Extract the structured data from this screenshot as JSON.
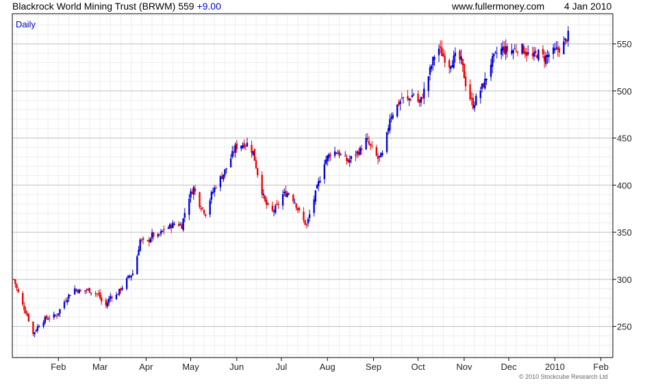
{
  "header": {
    "title": "Blackrock World Mining Trust (BRWM) 559",
    "change": "+9.00",
    "site": "www.fullermoney.com",
    "date": "4 Jan 2010"
  },
  "footer": {
    "copyright": "© 2010 Stockcube Research Ltd"
  },
  "colors": {
    "up": "#0000dd",
    "down": "#ee0000",
    "grid": "#d4d4d4",
    "axis": "#000000"
  },
  "chart_data": {
    "type": "line",
    "chart_style": "candlestick",
    "title": "Blackrock World Mining Trust (BRWM) 559 +9.00",
    "interval_label": "Daily",
    "xlabel": "",
    "ylabel": "",
    "ylim": [
      217,
      582
    ],
    "y_ticks": [
      250,
      300,
      350,
      400,
      450,
      500,
      550
    ],
    "x_ticks": [
      "Feb",
      "Mar",
      "Apr",
      "May",
      "Jun",
      "Jul",
      "Aug",
      "Sep",
      "Oct",
      "Nov",
      "Dec",
      "2010",
      "Feb"
    ],
    "x_domain_days": [
      0,
      404
    ],
    "x_tick_days": [
      31,
      59,
      90,
      120,
      151,
      181,
      212,
      243,
      273,
      304,
      334,
      365,
      396
    ],
    "grid": true,
    "y_axis_side": "right",
    "series": [
      {
        "points": [
          [
            1,
            300
          ],
          [
            6,
            276
          ],
          [
            10,
            262
          ],
          [
            14,
            242
          ],
          [
            18,
            252
          ],
          [
            22,
            258
          ],
          [
            26,
            260
          ],
          [
            30,
            262
          ],
          [
            34,
            274
          ],
          [
            38,
            283
          ],
          [
            42,
            290
          ],
          [
            46,
            287
          ],
          [
            50,
            289
          ],
          [
            54,
            287
          ],
          [
            58,
            284
          ],
          [
            62,
            269
          ],
          [
            66,
            282
          ],
          [
            70,
            283
          ],
          [
            74,
            292
          ],
          [
            78,
            302
          ],
          [
            82,
            308
          ],
          [
            86,
            342
          ],
          [
            90,
            337
          ],
          [
            94,
            347
          ],
          [
            98,
            345
          ],
          [
            102,
            353
          ],
          [
            106,
            356
          ],
          [
            110,
            360
          ],
          [
            114,
            357
          ],
          [
            118,
            385
          ],
          [
            122,
            397
          ],
          [
            126,
            380
          ],
          [
            130,
            370
          ],
          [
            134,
            390
          ],
          [
            138,
            403
          ],
          [
            142,
            412
          ],
          [
            146,
            425
          ],
          [
            150,
            440
          ],
          [
            154,
            443
          ],
          [
            158,
            444
          ],
          [
            162,
            435
          ],
          [
            166,
            405
          ],
          [
            170,
            382
          ],
          [
            174,
            370
          ],
          [
            178,
            377
          ],
          [
            182,
            390
          ],
          [
            186,
            392
          ],
          [
            190,
            383
          ],
          [
            194,
            367
          ],
          [
            198,
            357
          ],
          [
            202,
            380
          ],
          [
            206,
            402
          ],
          [
            210,
            425
          ],
          [
            214,
            434
          ],
          [
            218,
            436
          ],
          [
            222,
            430
          ],
          [
            226,
            425
          ],
          [
            230,
            432
          ],
          [
            234,
            437
          ],
          [
            238,
            448
          ],
          [
            242,
            438
          ],
          [
            246,
            428
          ],
          [
            250,
            433
          ],
          [
            254,
            472
          ],
          [
            258,
            482
          ],
          [
            262,
            492
          ],
          [
            266,
            490
          ],
          [
            270,
            497
          ],
          [
            274,
            486
          ],
          [
            278,
            505
          ],
          [
            282,
            527
          ],
          [
            286,
            548
          ],
          [
            290,
            537
          ],
          [
            294,
            528
          ],
          [
            298,
            536
          ],
          [
            302,
            532
          ],
          [
            306,
            500
          ],
          [
            310,
            485
          ],
          [
            314,
            498
          ],
          [
            318,
            510
          ],
          [
            322,
            530
          ],
          [
            326,
            540
          ],
          [
            330,
            545
          ],
          [
            334,
            542
          ],
          [
            338,
            544
          ],
          [
            342,
            547
          ],
          [
            346,
            540
          ],
          [
            350,
            536
          ],
          [
            354,
            540
          ],
          [
            358,
            535
          ],
          [
            362,
            540
          ],
          [
            366,
            543
          ],
          [
            370,
            547
          ],
          [
            374,
            559
          ]
        ]
      }
    ]
  }
}
